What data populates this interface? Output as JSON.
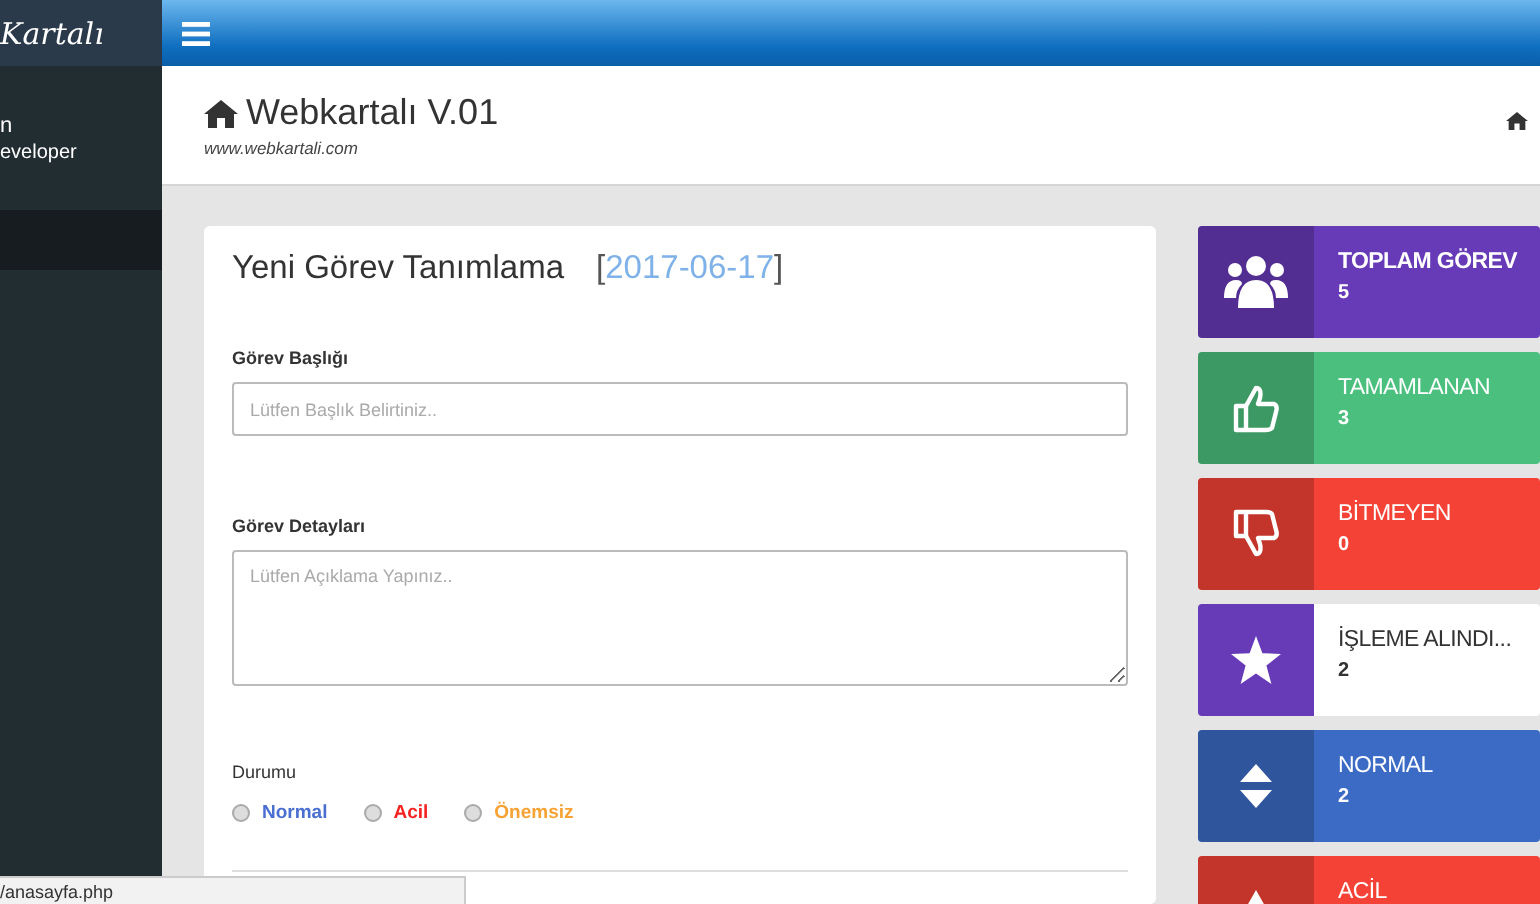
{
  "sidebar": {
    "logo": "Kartalı",
    "user_name": "n",
    "user_role": "eveloper"
  },
  "header": {
    "title": "Webkartalı V.01",
    "subtitle": "www.webkartali.com"
  },
  "form": {
    "title": "Yeni Görev Tanımlama",
    "date_open": "[",
    "date": "2017-06-17",
    "date_close": "]",
    "fields": [
      {
        "kind": "input",
        "label": "Görev Başlığı",
        "placeholder": "Lütfen Başlık Belirtiniz.."
      },
      {
        "kind": "textarea",
        "label": "Görev Detayları",
        "placeholder": "Lütfen Açıklama Yapınız.."
      }
    ],
    "status_label": "Durumu",
    "status_options": [
      {
        "label": "Normal",
        "color": "#4a6fd1",
        "selected": false
      },
      {
        "label": "Acil",
        "color": "#f52222",
        "selected": false
      },
      {
        "label": "Önemsiz",
        "color": "#f7a234",
        "selected": false
      }
    ]
  },
  "stats": [
    {
      "kind": "users",
      "title": "TOPLAM GÖREV",
      "count": "5",
      "color": "#673ab7",
      "light": false
    },
    {
      "kind": "thumbs-up",
      "title": "TAMAMLANAN",
      "count": "3",
      "color": "#4bc07e",
      "light": false
    },
    {
      "kind": "thumbs-down",
      "title": "BİTMEYEN",
      "count": "0",
      "color": "#f44336",
      "light": false
    },
    {
      "kind": "star",
      "title": "İŞLEME ALINDI...",
      "count": "2",
      "color": "#673ab7",
      "light": true
    },
    {
      "kind": "sort",
      "title": "NORMAL",
      "count": "2",
      "color": "#3b6bc4",
      "light": false
    },
    {
      "kind": "warning",
      "title": "ACİL",
      "color": "#f44336",
      "light": false
    }
  ],
  "status_url": "/anasayfa.php"
}
